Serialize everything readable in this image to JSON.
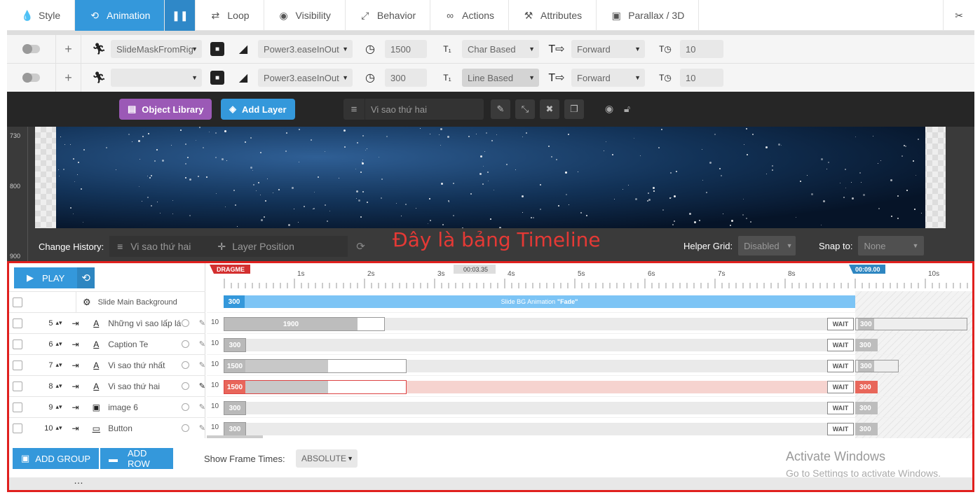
{
  "tabs": [
    {
      "label": "Style",
      "icon": "drop-icon"
    },
    {
      "label": "Animation",
      "icon": "history-icon"
    },
    {
      "label": "Loop",
      "icon": "loop-icon"
    },
    {
      "label": "Visibility",
      "icon": "eye-icon"
    },
    {
      "label": "Behavior",
      "icon": "expand-icon"
    },
    {
      "label": "Actions",
      "icon": "link-icon"
    },
    {
      "label": "Attributes",
      "icon": "tools-icon"
    },
    {
      "label": "Parallax / 3D",
      "icon": "image-icon"
    }
  ],
  "anim_in": {
    "transition": "SlideMaskFromRig",
    "ease": "Power3.easeInOut",
    "speed": "1500",
    "split": "Char Based",
    "direction": "Forward",
    "delay": "10"
  },
  "anim_out": {
    "transition": "",
    "ease": "Power3.easeInOut",
    "speed": "300",
    "split": "Line Based",
    "direction": "Forward",
    "delay": "10"
  },
  "toolbar": {
    "object_library": "Object Library",
    "add_layer": "Add Layer",
    "layer_name": "Vi sao thứ hai"
  },
  "ruler": {
    "r730": "730",
    "r800": "800",
    "r900": "900"
  },
  "history": {
    "label": "Change History:",
    "value": "Vi sao thứ hai",
    "position": "Layer Position"
  },
  "annotation": "Đây là bảng Timeline",
  "helper_grid": {
    "label": "Helper Grid:",
    "value": "Disabled"
  },
  "snap_to": {
    "label": "Snap to:",
    "value": "None"
  },
  "timeline": {
    "play": "PLAY",
    "dragme": "DRAGME",
    "current_time": "00:03.35",
    "end_time": "00:09.00",
    "seconds": [
      "1s",
      "2s",
      "3s",
      "4s",
      "5s",
      "6s",
      "7s",
      "8s",
      "",
      "10s"
    ],
    "bg_row": {
      "name": "Slide Main Background",
      "duration": "300",
      "label": "Slide BG Animation",
      "anim": "\"Fade\""
    },
    "layers": [
      {
        "num": "5",
        "type": "text",
        "name": "Những vì sao lấp lá",
        "delay": "10",
        "in": "1900",
        "wait": "WAIT",
        "out": "300"
      },
      {
        "num": "6",
        "type": "text",
        "name": "Caption Te",
        "delay": "10",
        "in": "300",
        "wait": "WAIT",
        "out": "300"
      },
      {
        "num": "7",
        "type": "text",
        "name": "Vi sao thứ nhất",
        "delay": "10",
        "in": "1500",
        "wait": "WAIT",
        "out": "300"
      },
      {
        "num": "8",
        "type": "text",
        "name": "Vi sao thứ hai",
        "delay": "10",
        "in": "1500",
        "wait": "WAIT",
        "out": "300"
      },
      {
        "num": "9",
        "type": "image",
        "name": "image 6",
        "delay": "10",
        "in": "300",
        "wait": "WAIT",
        "out": "300"
      },
      {
        "num": "10",
        "type": "button",
        "name": "Button",
        "delay": "10",
        "in": "300",
        "wait": "WAIT",
        "out": "300"
      }
    ],
    "add_group": "ADD GROUP",
    "add_row": "ADD ROW",
    "frame_times_label": "Show Frame Times:",
    "frame_times_value": "ABSOLUTE"
  },
  "windows": {
    "line1": "Activate Windows",
    "line2": "Go to Settings to activate Windows."
  },
  "colors": {
    "accent": "#3498db",
    "purple": "#9b59b6",
    "red": "#e0201e",
    "selected": "#e8665a"
  }
}
